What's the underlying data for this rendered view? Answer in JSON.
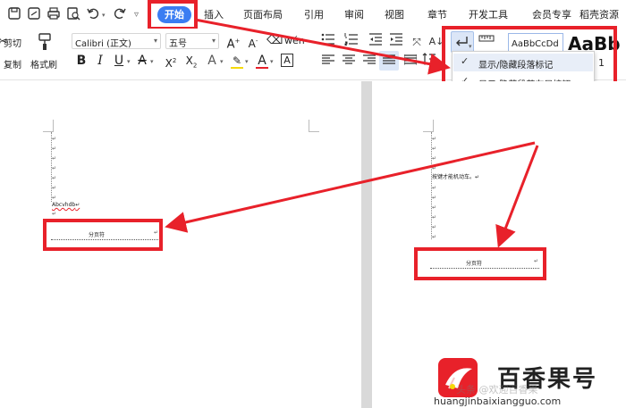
{
  "quick_access": [
    "save-icon",
    "save-as-icon",
    "print-icon",
    "print-preview-icon",
    "undo-icon",
    "redo-icon",
    "more-icon"
  ],
  "tabs": {
    "active": "开始",
    "insert": "插入",
    "page_layout": "页面布局",
    "references": "引用",
    "review": "审阅",
    "view": "视图",
    "section": "章节",
    "developer": "开发工具",
    "member": "会员专享",
    "more": "稻壳资源"
  },
  "clipboard": {
    "cut": "剪切",
    "copy": "复制",
    "format_painter": "格式刷"
  },
  "font": {
    "name": "Calibri (正文)",
    "size": "五号"
  },
  "styles": {
    "normal_preview": "AaBbCcDd",
    "heading_preview": "AaBb"
  },
  "dropdown": {
    "item1": "显示/隐藏段落标记",
    "item2": "显示/隐藏段落布局按钮"
  },
  "ribbon_fragment": "1",
  "doc": {
    "left_text": "Abcvhdb",
    "section_break_left": "分页符",
    "right_text": "按键才能机动车。",
    "section_break_right": "分页符"
  },
  "watermark": {
    "logo_text": "百香果号",
    "url": "huangjinbaixiangguo.com",
    "faint": "头条 @欢迎百香果"
  },
  "colors": {
    "accent": "#3b7df2",
    "highlight_red": "#e8212a",
    "toolbar_bg": "#ffffff",
    "doc_gap": "#d9d9d9"
  }
}
